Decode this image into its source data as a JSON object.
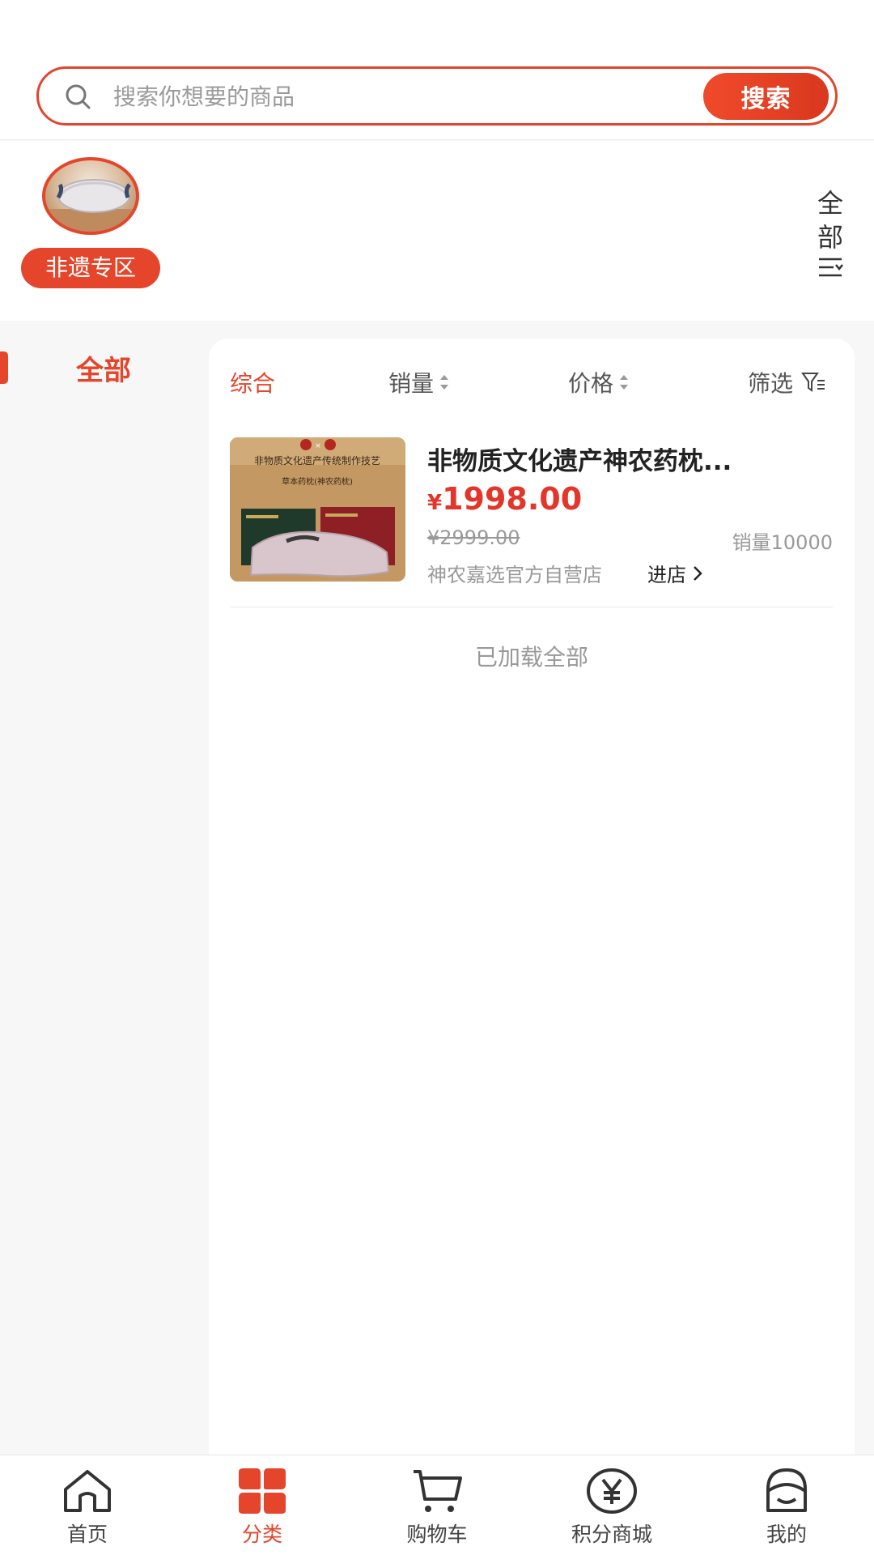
{
  "search": {
    "placeholder": "搜索你想要的商品",
    "button_label": "搜索"
  },
  "category_strip": {
    "items": [
      {
        "label": "非遗专区",
        "icon": "pillow-thumbnail"
      }
    ],
    "all_toggle": {
      "label_chars": [
        "全",
        "部"
      ],
      "icon": "menu-icon"
    }
  },
  "sidebar": {
    "items": [
      {
        "label": "全部",
        "active": true
      }
    ]
  },
  "sort_bar": {
    "items": [
      {
        "label": "综合",
        "active": true
      },
      {
        "label": "销量",
        "icon": "sort-arrows-icon"
      },
      {
        "label": "价格",
        "icon": "sort-arrows-icon"
      },
      {
        "label": "筛选",
        "icon": "filter-icon"
      }
    ]
  },
  "products": [
    {
      "title": "非物质文化遗产神农药枕...",
      "price_symbol": "¥",
      "price": "1998.00",
      "original_price": "¥2999.00",
      "sales": "销量10000",
      "store": "神农嘉选官方自营店",
      "enter_store": "进店",
      "image_text": {
        "headline": "非物质文化遗产传统制作技艺",
        "subtitle": "草本药枕(神农药枕)"
      }
    }
  ],
  "list_footer": "已加载全部",
  "tabbar": {
    "items": [
      {
        "label": "首页",
        "icon": "home-icon"
      },
      {
        "label": "分类",
        "icon": "category-icon",
        "active": true
      },
      {
        "label": "购物车",
        "icon": "cart-icon"
      },
      {
        "label": "积分商城",
        "icon": "points-mall-icon"
      },
      {
        "label": "我的",
        "icon": "profile-icon"
      }
    ]
  },
  "colors": {
    "accent": "#e4452b",
    "price": "#e4352a",
    "background": "#f7f7f7"
  }
}
